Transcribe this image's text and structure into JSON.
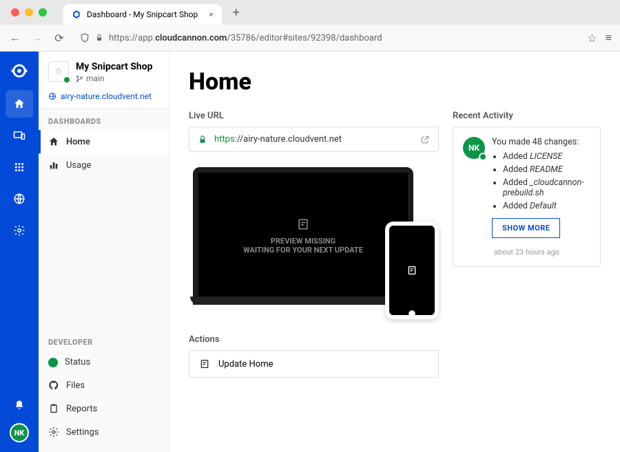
{
  "browser": {
    "tab_title": "Dashboard - My Snipcart Shop",
    "url_prefix": "https://app.",
    "url_domain": "cloudcannon.com",
    "url_suffix": "/35786/editor#sites/92398/dashboard"
  },
  "rail": {
    "avatar_initials": "NK"
  },
  "site": {
    "name": "My Snipcart Shop",
    "branch": "main",
    "live_domain": "airy-nature.cloudvent.net"
  },
  "nav": {
    "dashboards_label": "DASHBOARDS",
    "home": "Home",
    "usage": "Usage",
    "developer_label": "DEVELOPER",
    "status": "Status",
    "files": "Files",
    "reports": "Reports",
    "settings": "Settings"
  },
  "page": {
    "title": "Home",
    "live_url_label": "Live URL",
    "live_url_proto": "https:",
    "live_url_rest": "//airy-nature.cloudvent.net",
    "preview_line1": "PREVIEW MISSING",
    "preview_line2": "WAITING FOR YOUR NEXT UPDATE",
    "actions_label": "Actions",
    "update_home": "Update Home"
  },
  "activity": {
    "label": "Recent Activity",
    "avatar_initials": "NK",
    "summary": "You made 48 changes:",
    "items": [
      {
        "prefix": "Added ",
        "em": "LICENSE"
      },
      {
        "prefix": "Added ",
        "em": "README"
      },
      {
        "prefix": "Added ",
        "em": "_cloudcannon-prebuild.sh"
      },
      {
        "prefix": "Added ",
        "em": "Default"
      }
    ],
    "show_more": "SHOW MORE",
    "time": "about 23 hours ago"
  }
}
